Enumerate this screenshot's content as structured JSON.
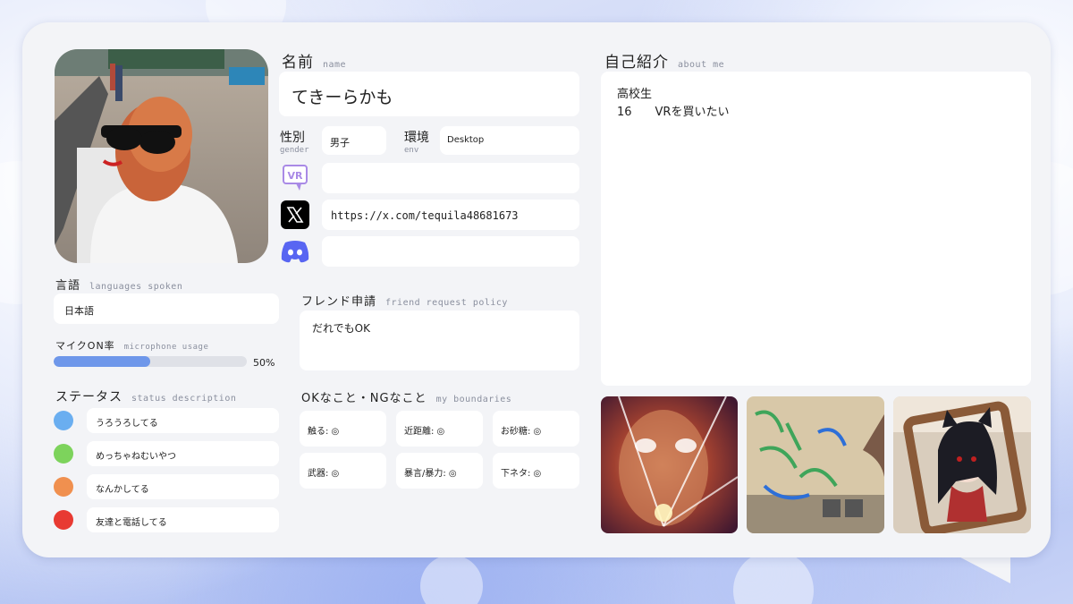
{
  "profile": {
    "name_label": "名前",
    "name_sub": "name",
    "name": "てきーらかも",
    "gender_label": "性別",
    "gender_sub": "gender",
    "gender": "男子",
    "env_label": "環境",
    "env_sub": "env",
    "env": "Desktop",
    "vr_id": "",
    "x_url": "https://x.com/tequila48681673",
    "discord_id": "",
    "vr_icon_text": "VR"
  },
  "languages": {
    "label": "言語",
    "sub": "languages spoken",
    "value": "日本語"
  },
  "mic": {
    "label": "マイクON率",
    "sub": "microphone usage",
    "percent_text": "50%",
    "fraction": 0.5
  },
  "status": {
    "label": "ステータス",
    "sub": "status description",
    "items": [
      {
        "text": "うろうろしてる",
        "color": "#6aaef0"
      },
      {
        "text": "めっちゃねむいやつ",
        "color": "#7dd35c"
      },
      {
        "text": "なんかしてる",
        "color": "#f0904f"
      },
      {
        "text": "友達と電話してる",
        "color": "#e83a32"
      }
    ]
  },
  "friend": {
    "label": "フレンド申請",
    "sub": "friend request policy",
    "value": "だれでもOK"
  },
  "boundaries": {
    "label": "OKなこと・NGなこと",
    "sub": "my boundaries",
    "items": [
      "触る: ◎",
      "近距離: ◎",
      "お砂糖: ◎",
      "武器: ◎",
      "暴言/暴力: ◎",
      "下ネタ: ◎"
    ]
  },
  "about": {
    "label": "自己紹介",
    "sub": "about me",
    "line1": "高校生",
    "line2": "16　　VRを買いたい"
  },
  "colors": {
    "accent": "#6e97ea",
    "card": "#f3f4f7",
    "discord": "#5865f2",
    "vr_icon": "#a98ae6"
  }
}
